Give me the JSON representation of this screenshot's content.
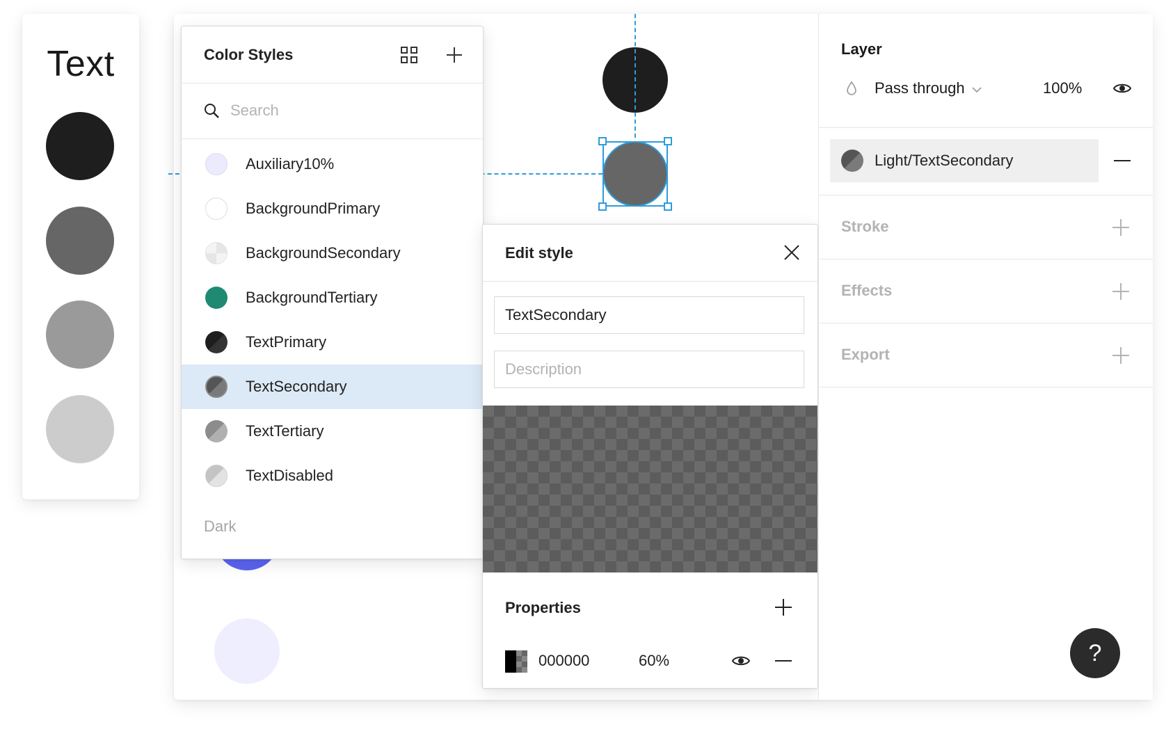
{
  "swatch_card": {
    "title": "Text",
    "swatches": [
      "#1e1e1e",
      "#666666",
      "#9a9a9a",
      "#cccccc"
    ]
  },
  "canvas": {
    "circles": [
      {
        "name": "top-dark-circle",
        "color": "#1e1e1e"
      },
      {
        "name": "selected-circle",
        "color": "#666666"
      },
      {
        "name": "purple-circle",
        "color": "#5b63f0"
      },
      {
        "name": "lavender-circle",
        "color": "#eeeefe"
      }
    ],
    "selection_color": "#2d9cdb"
  },
  "color_styles": {
    "title": "Color Styles",
    "search_placeholder": "Search",
    "items": [
      {
        "label": "Auxiliary10%",
        "color": "#ecebfd"
      },
      {
        "label": "BackgroundPrimary",
        "color": "#ffffff"
      },
      {
        "label": "BackgroundSecondary",
        "color": "#ececec"
      },
      {
        "label": "BackgroundTertiary",
        "color": "#1e8a72"
      },
      {
        "label": "TextPrimary",
        "color": "#1e1e1e"
      },
      {
        "label": "TextSecondary",
        "color": "#666666",
        "selected": true
      },
      {
        "label": "TextTertiary",
        "color": "#9a9a9a"
      },
      {
        "label": "TextDisabled",
        "color": "#cccccc"
      }
    ],
    "group_label": "Dark"
  },
  "edit_style": {
    "title": "Edit style",
    "name_value": "TextSecondary",
    "description_placeholder": "Description",
    "properties_title": "Properties",
    "fill_hex": "000000",
    "fill_opacity": "60%"
  },
  "right_panel": {
    "layer_title": "Layer",
    "blend_mode": "Pass through",
    "opacity": "100%",
    "fill_style_name": "Light/TextSecondary",
    "stroke_title": "Stroke",
    "effects_title": "Effects",
    "export_title": "Export"
  },
  "help_label": "?"
}
